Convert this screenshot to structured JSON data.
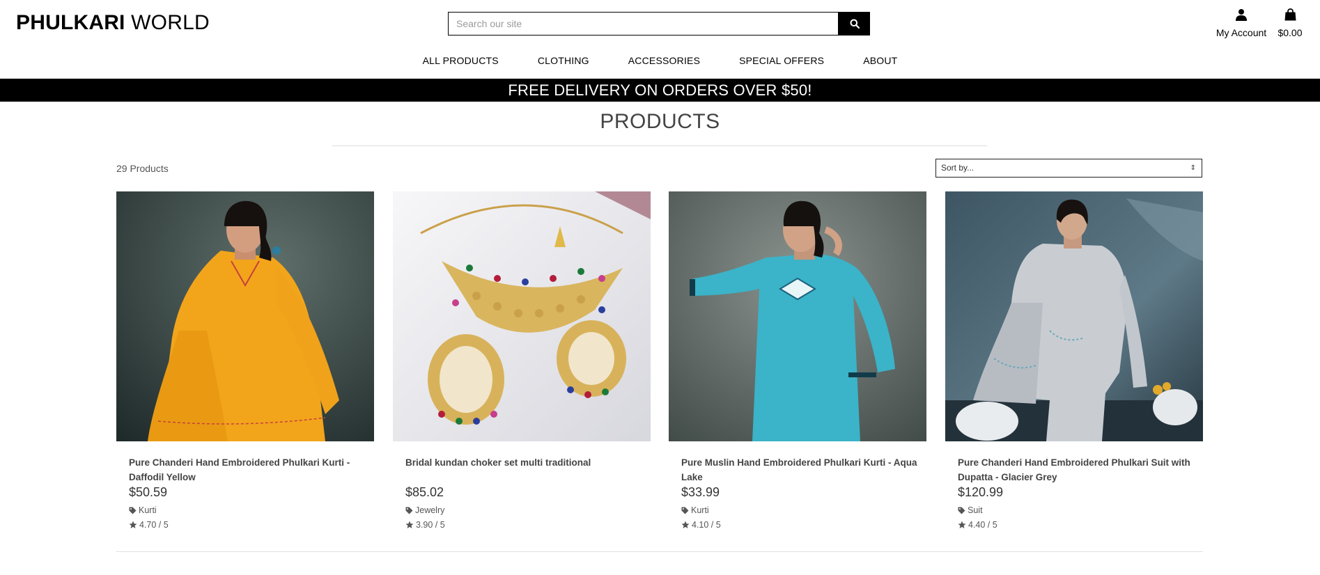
{
  "header": {
    "logo_bold": "PHULKARI",
    "logo_light": "WORLD",
    "search": {
      "placeholder": "Search our site",
      "value": ""
    },
    "account_label": "My Account",
    "bag_total": "$0.00",
    "icons": {
      "search": "search-icon",
      "account": "user-icon",
      "bag": "shopping-bag-icon"
    }
  },
  "nav": [
    "ALL PRODUCTS",
    "CLOTHING",
    "ACCESSORIES",
    "SPECIAL OFFERS",
    "ABOUT"
  ],
  "banner": "FREE DELIVERY ON ORDERS OVER $50!",
  "page_title": "PRODUCTS",
  "product_count": "29 Products",
  "sort": {
    "selected": "Sort by..."
  },
  "products": [
    {
      "name": "Pure Chanderi Hand Embroidered Phulkari Kurti - Daffodil Yellow",
      "price": "$50.59",
      "category": "Kurti",
      "rating": "4.70 / 5"
    },
    {
      "name": "Bridal kundan choker set multi traditional",
      "price": "$85.02",
      "category": "Jewelry",
      "rating": "3.90 / 5"
    },
    {
      "name": "Pure Muslin Hand Embroidered Phulkari Kurti - Aqua Lake",
      "price": "$33.99",
      "category": "Kurti",
      "rating": "4.10 / 5"
    },
    {
      "name": "Pure Chanderi Hand Embroidered Phulkari Suit with Dupatta - Glacier Grey",
      "price": "$120.99",
      "category": "Suit",
      "rating": "4.40 / 5"
    }
  ],
  "colors": {
    "text": "#333333",
    "banner_bg": "#000000",
    "accent": "#000000"
  }
}
